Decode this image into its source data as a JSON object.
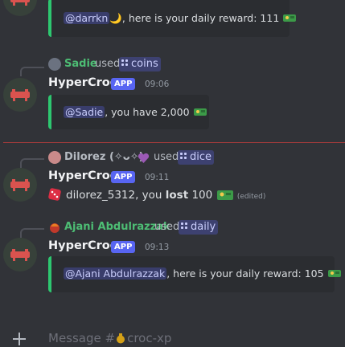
{
  "messages": {
    "top_embed": {
      "mention": "@darrkn",
      "text": ", here is your daily reward: 111"
    },
    "m1": {
      "reply_user": "Sadie",
      "reply_used": "used",
      "reply_command": "coins",
      "bot_name": "HyperCroc",
      "badge": "APP",
      "time": "09:06",
      "embed_mention": "@Sadie",
      "embed_text": ", you have 2,000"
    },
    "m2": {
      "reply_user": "Dilorez (✧ᴗ✧)",
      "reply_used": "used",
      "reply_command": "dice",
      "bot_name": "HyperCroc",
      "badge": "APP",
      "time": "09:11",
      "text_prefix": "dilorez_5312, you ",
      "text_bold": "lost",
      "text_amount": " 100",
      "edited": "(edited)"
    },
    "m3": {
      "reply_user": "Ajani Abdulrazzak",
      "reply_used": "used",
      "reply_command": "daily",
      "bot_name": "HyperCroc",
      "badge": "APP",
      "time": "09:13",
      "embed_mention": "@Ajani Abdulrazzak",
      "embed_text": ", here is your daily reward: 105"
    }
  },
  "composer": {
    "placeholder": "Message #",
    "channel": "croc-xp"
  },
  "colors": {
    "background": "#313338",
    "embed_bar": "#2dc770",
    "app_badge": "#5865f2",
    "sadie_name": "#4dbd74",
    "dilorez_name": "#b5bac1",
    "ajani_name": "#4dbd74",
    "divider": "#a33b3b"
  },
  "icons": [
    "hypercroc-avatar",
    "money-croc-emoji",
    "dice-emoji",
    "purple-heart-emoji",
    "money-bag-emoji",
    "plus-icon",
    "slash-command-icon"
  ]
}
